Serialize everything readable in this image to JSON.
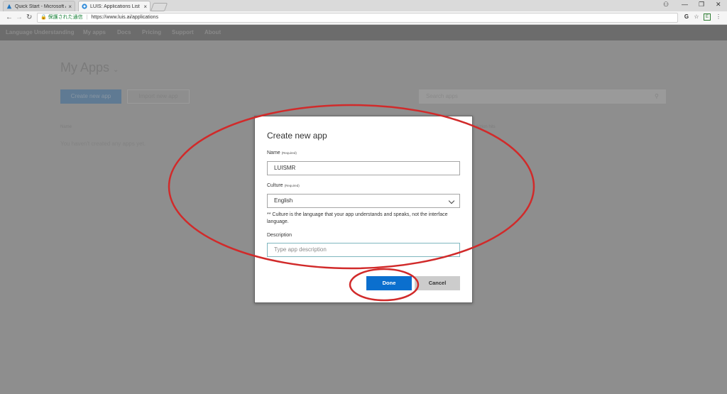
{
  "browser": {
    "tabs": [
      {
        "title": "Quick Start - Microsoft A",
        "close": "×"
      },
      {
        "title": "LUIS: Applications List Pa",
        "close": "×"
      }
    ],
    "secure_label": "保護された通信",
    "url": "https://www.luis.ai/applications",
    "nav": {
      "back": "←",
      "forward": "→",
      "reload": "↻"
    },
    "window_controls": {
      "account": "⚇",
      "minimize": "—",
      "restore": "❐",
      "close": "✕"
    },
    "toolbar_icons": {
      "translate": "G",
      "star": "☆",
      "extension": "E",
      "menu": "⋮"
    }
  },
  "site_nav": {
    "brand": "Language Understanding",
    "items": [
      "My apps",
      "Docs",
      "Pricing",
      "Support",
      "About"
    ]
  },
  "page": {
    "title": "My Apps",
    "title_icon": "⌄",
    "create_button": "Create new app",
    "import_button": "Import new app",
    "search_placeholder": "Search apps",
    "columns": {
      "name": "Name",
      "last": "Action hits"
    },
    "empty_text": "You haven't created any apps yet."
  },
  "modal": {
    "title": "Create new app",
    "name_label": "Name",
    "required": "(Required)",
    "name_value": "LUISMR",
    "culture_label": "Culture",
    "culture_value": "English",
    "culture_note": "** Culture is the language that your app understands and speaks, not the interface language.",
    "description_label": "Description",
    "description_placeholder": "Type app description",
    "done_button": "Done",
    "cancel_button": "Cancel"
  },
  "colors": {
    "annotation": "#d12a2a",
    "primary": "#0b6fce"
  }
}
